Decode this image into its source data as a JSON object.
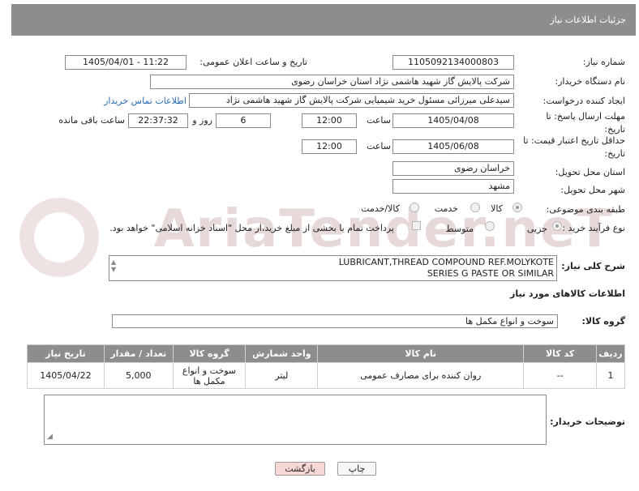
{
  "header": {
    "title": "جزئیات اطلاعات نیاز"
  },
  "watermark": {
    "text": "AriaTender.neT"
  },
  "fields": {
    "need_number_label": "شماره نیاز:",
    "need_number": "1105092134000803",
    "announce_label": "تاریخ و ساعت اعلان عمومی:",
    "announce_value": "1405/04/01 - 11:22",
    "buyer_label": "نام دستگاه خریدار:",
    "buyer_value": "شرکت پالایش گاز شهید هاشمی نژاد   استان خراسان رضوی",
    "creator_label": "ایجاد کننده درخواست:",
    "creator_value": "سیدعلی میرزائی مسئول خرید شیمیایی شرکت پالایش گاز شهید هاشمی نژاد",
    "contact_link": "اطلاعات تماس خریدار",
    "deadline_label": "مهلت ارسال پاسخ: تا تاریخ:",
    "deadline_date": "1405/04/08",
    "time_label": "ساعت",
    "deadline_time": "12:00",
    "days_value": "6",
    "days_label": "روز و",
    "remaining_time": "22:37:32",
    "remaining_label": "ساعت باقی مانده",
    "price_label": "حداقل تاریخ اعتبار قیمت: تا تاریخ:",
    "price_date": "1405/06/08",
    "price_time_label": "ساعت",
    "price_time": "12:00",
    "province_label": "استان محل تحویل:",
    "province_value": "خراسان رضوی",
    "city_label": "شهر محل تحویل:",
    "city_value": "مشهد",
    "category_label": "طبقه بندی موضوعی:",
    "category_options": [
      "کالا",
      "خدمت",
      "کالا/خدمت"
    ],
    "process_label": "نوع فرآیند خرید :",
    "process_options": [
      "جزیی",
      "متوسط"
    ],
    "payment_note": "پرداخت تمام یا بخشی از مبلغ خرید،از محل \"اسناد خزانه اسلامی\" خواهد بود."
  },
  "description": {
    "label": "شرح کلی نیاز:",
    "line1": "LUBRICANT,THREAD COMPOUND REF.MOLYKOTE",
    "line2": "SERIES G PASTE OR SIMILAR"
  },
  "goods": {
    "section_title": "اطلاعات کالاهای مورد نیاز",
    "group_label": "گروه کالا:",
    "group_value": "سوخت و انواع مکمل ها",
    "columns": [
      "ردیف",
      "کد کالا",
      "نام کالا",
      "واحد شمارش",
      "گروه کالا",
      "تعداد / مقدار",
      "تاریخ نیاز"
    ],
    "rows": [
      {
        "row": "1",
        "code": "--",
        "name": "روان کننده برای مصارف عمومی",
        "unit": "لیتر",
        "group": "سوخت و انواع مکمل ها",
        "qty": "5,000",
        "date": "1405/04/22"
      }
    ]
  },
  "buyer_notes": {
    "label": "توضیحات خریدار:",
    "value": ""
  },
  "buttons": {
    "print": "چاپ",
    "back": "بازگشت"
  }
}
